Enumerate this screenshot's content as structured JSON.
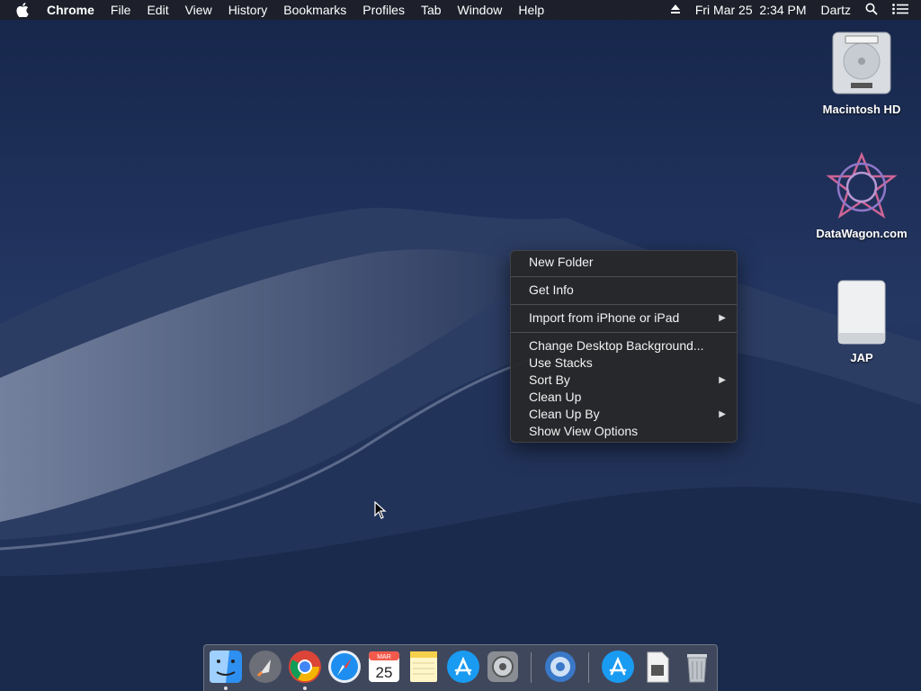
{
  "menubar": {
    "app_name": "Chrome",
    "menus": [
      "File",
      "Edit",
      "View",
      "History",
      "Bookmarks",
      "Profiles",
      "Tab",
      "Window",
      "Help"
    ],
    "datetime": "Fri Mar 25  2:34 PM",
    "user": "Dartz"
  },
  "desktop": {
    "icons": [
      {
        "label": "Macintosh HD",
        "icon": "hard-drive-icon"
      },
      {
        "label": "DataWagon.com",
        "icon": "datawagon-icon"
      },
      {
        "label": "JAP",
        "icon": "external-drive-icon"
      }
    ]
  },
  "context_menu": {
    "items": [
      {
        "label": "New Folder"
      },
      {
        "label": "Get Info"
      },
      {
        "label": "Import from iPhone or iPad",
        "submenu": true
      },
      {
        "label": "Change Desktop Background..."
      },
      {
        "label": "Use Stacks"
      },
      {
        "label": "Sort By",
        "submenu": true
      },
      {
        "label": "Clean Up"
      },
      {
        "label": "Clean Up By",
        "submenu": true
      },
      {
        "label": "Show View Options"
      }
    ]
  },
  "dock": {
    "apps": [
      {
        "name": "Finder",
        "icon": "finder-icon",
        "running": true
      },
      {
        "name": "Launchpad",
        "icon": "launchpad-icon",
        "running": false
      },
      {
        "name": "Google Chrome",
        "icon": "chrome-icon",
        "running": true
      },
      {
        "name": "Safari",
        "icon": "safari-icon",
        "running": false
      },
      {
        "name": "Calendar",
        "icon": "calendar-icon",
        "running": false,
        "month": "MAR",
        "day": "25"
      },
      {
        "name": "Notes",
        "icon": "notes-icon",
        "running": false
      },
      {
        "name": "App Store",
        "icon": "app-store-icon",
        "running": false
      },
      {
        "name": "System Preferences",
        "icon": "system-preferences-icon",
        "running": false
      },
      {
        "name": "Downloads Utility",
        "icon": "utility-app-icon",
        "running": false
      },
      {
        "name": "Applications",
        "icon": "applications-folder-icon",
        "running": false
      },
      {
        "name": "Documents",
        "icon": "document-stack-icon",
        "running": false
      },
      {
        "name": "Trash",
        "icon": "trash-icon",
        "running": false
      }
    ]
  }
}
